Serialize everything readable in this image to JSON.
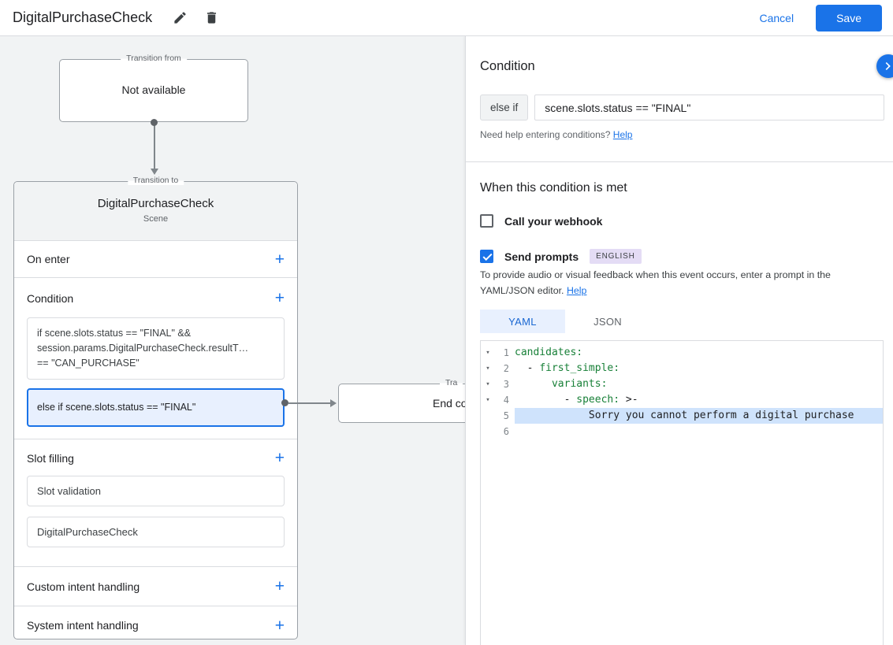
{
  "header": {
    "title": "DigitalPurchaseCheck",
    "cancel_label": "Cancel",
    "save_label": "Save"
  },
  "canvas": {
    "transition_from": {
      "label": "Transition from",
      "value": "Not available"
    },
    "scene": {
      "label": "Transition to",
      "title": "DigitalPurchaseCheck",
      "subtitle": "Scene",
      "on_enter_label": "On enter",
      "condition_label": "Condition",
      "condition_1_lines": [
        "if scene.slots.status == \"FINAL\" &&",
        "session.params.DigitalPurchaseCheck.resultT…",
        "== \"CAN_PURCHASE\""
      ],
      "condition_2": "else if scene.slots.status == \"FINAL\"",
      "slot_filling_label": "Slot filling",
      "slot_boxes": [
        "Slot validation",
        "DigitalPurchaseCheck"
      ],
      "custom_intent_label": "Custom intent handling",
      "system_intent_label": "System intent handling"
    },
    "end_node": {
      "label": "Tra",
      "value": "End co"
    }
  },
  "panel": {
    "title": "Condition",
    "condition_prefix": "else if",
    "condition_value": "scene.slots.status == \"FINAL\"",
    "help_text": "Need help entering conditions?",
    "help_link": "Help",
    "met_heading": "When this condition is met",
    "webhook": {
      "label": "Call your webhook",
      "checked": false
    },
    "prompts": {
      "label": "Send prompts",
      "checked": true,
      "badge": "ENGLISH"
    },
    "hint_text": "To provide audio or visual feedback when this event occurs, enter a prompt in the YAML/JSON editor.",
    "hint_link": "Help",
    "tabs": [
      {
        "label": "YAML",
        "active": true
      },
      {
        "label": "JSON",
        "active": false
      }
    ],
    "editor": {
      "lines": [
        {
          "num": "1",
          "fold": true,
          "highlight": false,
          "segments": [
            {
              "text": "candidates:",
              "type": "key"
            }
          ]
        },
        {
          "num": "2",
          "fold": true,
          "highlight": false,
          "segments": [
            {
              "text": "  - ",
              "type": "plain"
            },
            {
              "text": "first_simple:",
              "type": "key"
            }
          ]
        },
        {
          "num": "3",
          "fold": true,
          "highlight": false,
          "segments": [
            {
              "text": "      ",
              "type": "plain"
            },
            {
              "text": "variants:",
              "type": "key"
            }
          ]
        },
        {
          "num": "4",
          "fold": true,
          "highlight": false,
          "segments": [
            {
              "text": "        - ",
              "type": "plain"
            },
            {
              "text": "speech:",
              "type": "key"
            },
            {
              "text": " >-",
              "type": "plain"
            }
          ]
        },
        {
          "num": "5",
          "fold": false,
          "highlight": true,
          "segments": [
            {
              "text": "            Sorry you cannot perform a digital purchase",
              "type": "plain"
            }
          ]
        },
        {
          "num": "6",
          "fold": false,
          "highlight": false,
          "segments": []
        }
      ]
    }
  }
}
